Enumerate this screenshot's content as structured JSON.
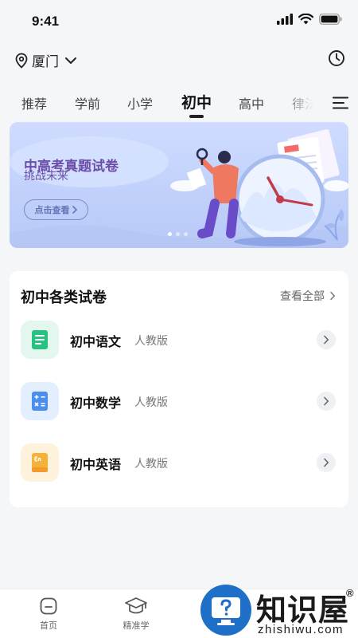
{
  "status_bar": {
    "time": "9:41"
  },
  "location": {
    "city": "厦门"
  },
  "tabs": [
    {
      "label": "推荐"
    },
    {
      "label": "学前"
    },
    {
      "label": "小学"
    },
    {
      "label": "初中",
      "active": true
    },
    {
      "label": "高中"
    },
    {
      "label": "律法"
    }
  ],
  "banner": {
    "title": "中高考真题试卷",
    "subtitle": "挑战未来",
    "button_label": "点击查看",
    "slide_count": 3,
    "active_slide": 1
  },
  "papers_section": {
    "title": "初中各类试卷",
    "see_all_label": "查看全部",
    "subjects": [
      {
        "name": "初中语文",
        "edition": "人教版",
        "icon": "document-lines-icon",
        "icon_bg": "#e3f7ef",
        "icon_color": "#27c281"
      },
      {
        "name": "初中数学",
        "edition": "人教版",
        "icon": "calculator-icon",
        "icon_bg": "#e3efff",
        "icon_color": "#4a8ff0"
      },
      {
        "name": "初中英语",
        "edition": "人教版",
        "icon": "english-book-icon",
        "icon_bg": "#fff2dc",
        "icon_color": "#f5b23a"
      }
    ]
  },
  "bottom_nav": {
    "items": [
      {
        "label": "首页",
        "icon": "home-icon"
      },
      {
        "label": "精准学",
        "icon": "graduation-cap-icon"
      }
    ]
  },
  "watermark": {
    "brand": "知识屋",
    "url": "zhishiwu.com"
  }
}
